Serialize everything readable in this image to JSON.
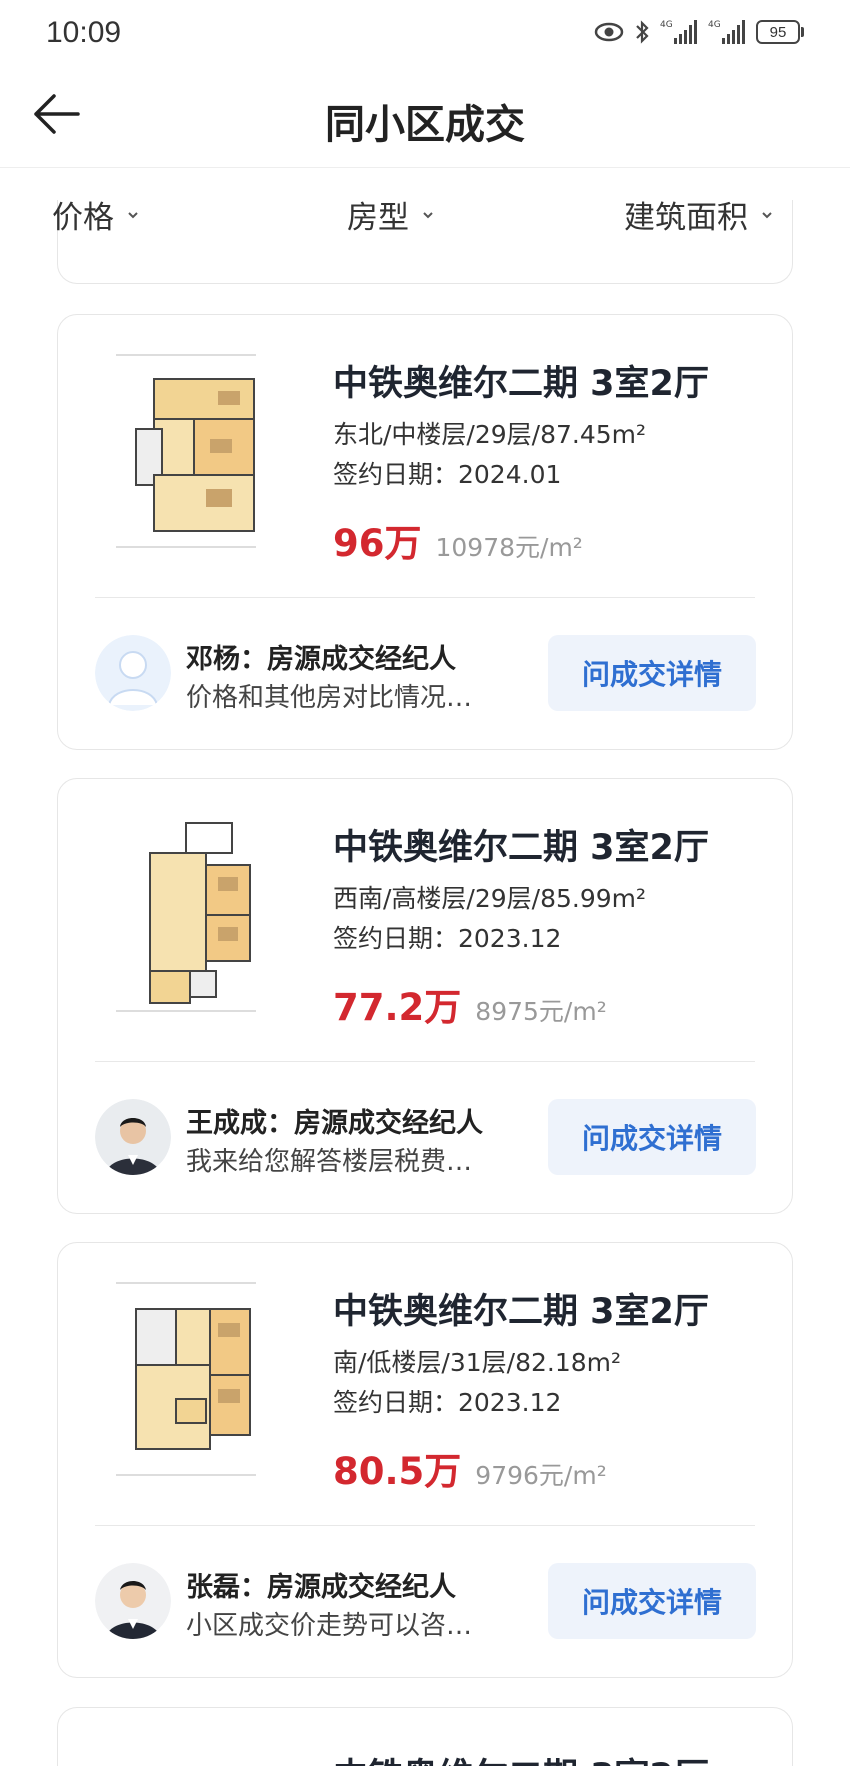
{
  "status_bar": {
    "time": "10:09",
    "battery": "95"
  },
  "header": {
    "title": "同小区成交"
  },
  "filters": [
    {
      "label": "价格"
    },
    {
      "label": "房型"
    },
    {
      "label": "建筑面积"
    }
  ],
  "listings": [
    {
      "title": "中铁奥维尔二期 3室2厅",
      "info": "东北/中楼层/29层/87.45m²",
      "date": "签约日期：2024.01",
      "price": "96万",
      "unit_price": "10978元/m²",
      "agent_name": "邓杨：房源成交经纪人",
      "agent_message": "价格和其他房对比情况…",
      "button": "问成交详情"
    },
    {
      "title": "中铁奥维尔二期 3室2厅",
      "info": "西南/高楼层/29层/85.99m²",
      "date": "签约日期：2023.12",
      "price": "77.2万",
      "unit_price": "8975元/m²",
      "agent_name": "王成成：房源成交经纪人",
      "agent_message": "我来给您解答楼层税费…",
      "button": "问成交详情"
    },
    {
      "title": "中铁奥维尔二期 3室2厅",
      "info": "南/低楼层/31层/82.18m²",
      "date": "签约日期：2023.12",
      "price": "80.5万",
      "unit_price": "9796元/m²",
      "agent_name": "张磊：房源成交经纪人",
      "agent_message": "小区成交价走势可以咨…",
      "button": "问成交详情"
    },
    {
      "title": "中铁奥维尔二期 3室2厅"
    }
  ],
  "icons": {
    "back": "arrow-left-icon",
    "chevron": "chevron-down-icon",
    "eye": "eye-icon",
    "bluetooth": "bluetooth-icon",
    "signal": "signal-icon",
    "battery": "battery-icon"
  },
  "colors": {
    "price": "#d3282f",
    "button_bg": "#eef3fb",
    "button_text": "#2f6fd1"
  }
}
